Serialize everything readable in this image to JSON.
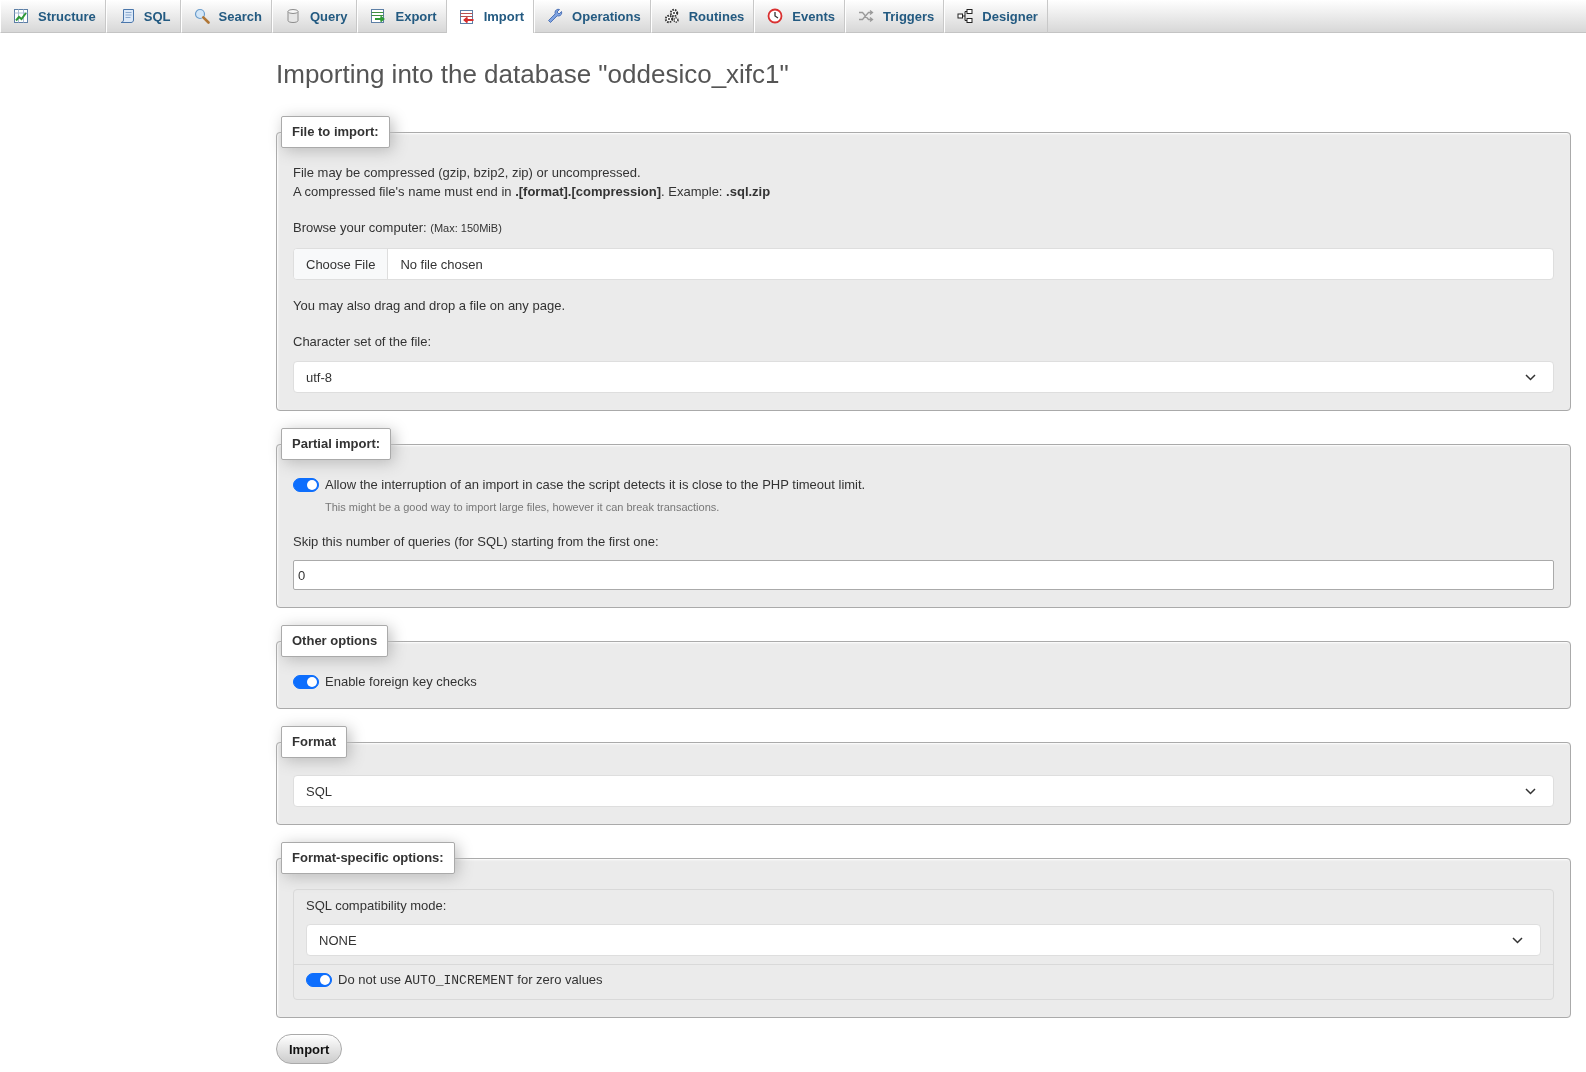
{
  "tabs": [
    {
      "label": "Structure",
      "selected": false
    },
    {
      "label": "SQL",
      "selected": false
    },
    {
      "label": "Search",
      "selected": false
    },
    {
      "label": "Query",
      "selected": false
    },
    {
      "label": "Export",
      "selected": false
    },
    {
      "label": "Import",
      "selected": true
    },
    {
      "label": "Operations",
      "selected": false
    },
    {
      "label": "Routines",
      "selected": false
    },
    {
      "label": "Events",
      "selected": false
    },
    {
      "label": "Triggers",
      "selected": false
    },
    {
      "label": "Designer",
      "selected": false
    }
  ],
  "title": "Importing into the database \"oddesico_xifc1\"",
  "file_to_import": {
    "legend": "File to import:",
    "notes": [
      "File may be compressed (gzip, bzip2, zip) or uncompressed.",
      "A compressed file's name must end in **.[format].[compression]**. Example: **.sql.zip**"
    ],
    "browse_label": "Browse your computer:",
    "max_size": "(Max: 150MiB)",
    "file_button": "Choose File",
    "file_status": "No file chosen",
    "drag_hint": "You may also drag and drop a file on any page.",
    "charset_label": "Character set of the file:",
    "charset": "utf-8"
  },
  "partial_import": {
    "legend": "Partial import:",
    "allow_interruption": {
      "label": "Allow the interruption of an import in case the script detects it is close to the PHP timeout limit.",
      "on": true
    },
    "interruption_hint": "This might be a good way to import large files, however it can break transactions.",
    "skip_label": "Skip this number of queries (for SQL) starting from the first one:",
    "skip_queries": "0"
  },
  "other_options": {
    "legend": "Other options",
    "foreign_key_checks": {
      "label": "Enable foreign key checks",
      "on": true
    }
  },
  "format": {
    "legend": "Format",
    "value": "SQL"
  },
  "format_specific_options": {
    "legend": "Format-specific options:",
    "compatibility_label": "SQL compatibility mode:",
    "compatibility_mode": "NONE",
    "no_auto_increment": {
      "label_before": "Do not use",
      "code": "AUTO_INCREMENT",
      "label_after": "for zero values",
      "on": true
    }
  },
  "import_button": "Import"
}
